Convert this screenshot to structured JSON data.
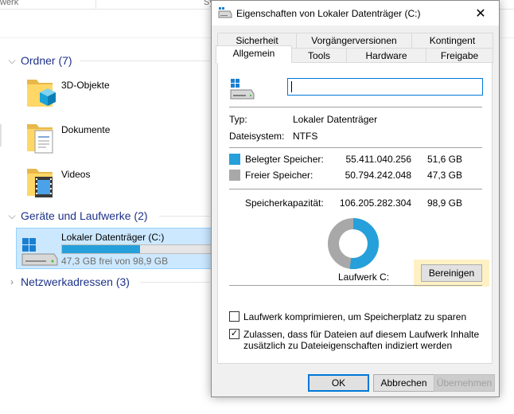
{
  "explorer": {
    "columns": [
      {
        "label": "werk"
      },
      {
        "label": "Sy"
      }
    ],
    "groups": [
      {
        "label": "Ordner (7)",
        "expanded": true
      },
      {
        "label": "Geräte und Laufwerke (2)",
        "expanded": true
      },
      {
        "label": "Netzwerkadressen (3)",
        "expanded": false
      }
    ],
    "folders": [
      {
        "label": "3D-Objekte",
        "icon": "3d-objects-folder-icon"
      },
      {
        "label": "Dokumente",
        "icon": "documents-folder-icon"
      },
      {
        "label": "Videos",
        "icon": "videos-folder-icon"
      }
    ],
    "drive": {
      "label": "Lokaler Datenträger (C:)",
      "free_text": "47,3 GB frei von 98,9 GB",
      "used_fraction": 0.522
    }
  },
  "dialog": {
    "title": "Eigenschaften von Lokaler Datenträger (C:)",
    "close_symbol": "✕",
    "tabs_back": [
      {
        "label": "Sicherheit"
      },
      {
        "label": "Vorgängerversionen"
      },
      {
        "label": "Kontingent"
      }
    ],
    "tabs_front": [
      {
        "label": "Allgemein",
        "active": true
      },
      {
        "label": "Tools"
      },
      {
        "label": "Hardware"
      },
      {
        "label": "Freigabe"
      }
    ],
    "general": {
      "name_value": "",
      "type_label": "Typ:",
      "type_value": "Lokaler Datenträger",
      "fs_label": "Dateisystem:",
      "fs_value": "NTFS",
      "used_label": "Belegter Speicher:",
      "used_bytes": "55.411.040.256",
      "used_gb": "51,6 GB",
      "free_label": "Freier Speicher:",
      "free_bytes": "50.794.242.048",
      "free_gb": "47,3 GB",
      "capacity_label": "Speicherkapazität:",
      "capacity_bytes": "106.205.282.304",
      "capacity_gb": "98,9 GB",
      "drive_label": "Laufwerk C:",
      "cleanup_button": "Bereinigen",
      "used_fraction": 0.522,
      "compress_label": "Laufwerk komprimieren, um Speicherplatz zu sparen",
      "compress_checked": false,
      "index_label_line1": "Zulassen, dass für Dateien auf diesem Laufwerk Inhalte",
      "index_label_line2": "zusätzlich zu Dateieigenschaften indiziert werden",
      "index_checked": true,
      "check_symbol": "✓"
    },
    "buttons": {
      "ok": "OK",
      "cancel": "Abbrechen",
      "apply": "Übernehmen"
    }
  },
  "colors": {
    "used": "#26a0da",
    "free": "#a8a8a8",
    "accent": "#0078d7",
    "group_header": "#1e3287",
    "highlight": "#fff1c4"
  }
}
